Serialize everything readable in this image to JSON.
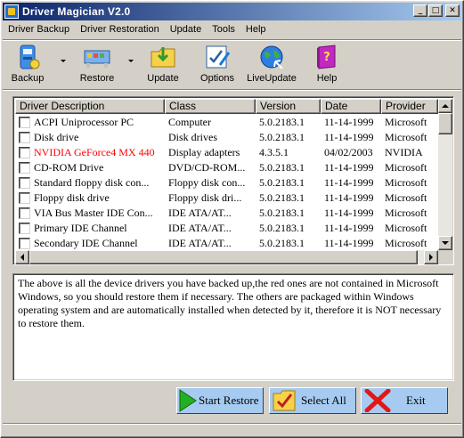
{
  "window": {
    "title": "Driver Magician V2.0"
  },
  "title_buttons": {
    "minimize": "_",
    "maximize": "□",
    "close": "✕"
  },
  "menu": [
    "Driver Backup",
    "Driver Restoration",
    "Update",
    "Tools",
    "Help"
  ],
  "toolbar": [
    {
      "label": "Backup",
      "icon": "backup-icon",
      "has_dropdown": true
    },
    {
      "label": "Restore",
      "icon": "restore-icon",
      "has_dropdown": true
    },
    {
      "label": "Update",
      "icon": "update-folder-icon",
      "has_dropdown": false
    },
    {
      "label": "Options",
      "icon": "options-icon",
      "has_dropdown": false
    },
    {
      "label": "LiveUpdate",
      "icon": "globe-icon",
      "has_dropdown": false
    },
    {
      "label": "Help",
      "icon": "help-book-icon",
      "has_dropdown": false
    }
  ],
  "driver_list": {
    "columns": [
      "Driver Description",
      "Class",
      "Version",
      "Date",
      "Provider"
    ],
    "rows": [
      {
        "description": "ACPI Uniprocessor PC",
        "class": "Computer",
        "version": "5.0.2183.1",
        "date": "11-14-1999",
        "provider": "Microsoft",
        "missing": false
      },
      {
        "description": "Disk drive",
        "class": "Disk drives",
        "version": "5.0.2183.1",
        "date": "11-14-1999",
        "provider": "Microsoft",
        "missing": false
      },
      {
        "description": "NVIDIA GeForce4 MX 440",
        "class": "Display adapters",
        "version": "4.3.5.1",
        "date": "04/02/2003",
        "provider": "NVIDIA",
        "missing": true
      },
      {
        "description": "CD-ROM Drive",
        "class": "DVD/CD-ROM...",
        "version": "5.0.2183.1",
        "date": "11-14-1999",
        "provider": "Microsoft",
        "missing": false
      },
      {
        "description": "Standard floppy disk con...",
        "class": "Floppy disk con...",
        "version": "5.0.2183.1",
        "date": "11-14-1999",
        "provider": "Microsoft",
        "missing": false
      },
      {
        "description": "Floppy disk drive",
        "class": "Floppy disk dri...",
        "version": "5.0.2183.1",
        "date": "11-14-1999",
        "provider": "Microsoft",
        "missing": false
      },
      {
        "description": "VIA Bus Master IDE Con...",
        "class": "IDE ATA/AT...",
        "version": "5.0.2183.1",
        "date": "11-14-1999",
        "provider": "Microsoft",
        "missing": false
      },
      {
        "description": "Primary IDE Channel",
        "class": "IDE ATA/AT...",
        "version": "5.0.2183.1",
        "date": "11-14-1999",
        "provider": "Microsoft",
        "missing": false
      },
      {
        "description": "Secondary IDE Channel",
        "class": "IDE ATA/AT...",
        "version": "5.0.2183.1",
        "date": "11-14-1999",
        "provider": "Microsoft",
        "missing": false
      }
    ]
  },
  "info": {
    "text": " The above is all the device drivers you have backed up,the red ones are not contained in Microsoft Windows, so you should restore them if necessary. The others are packaged within Windows operating system and are automatically installed when detected by it, therefore it is NOT necessary to restore them."
  },
  "buttons": {
    "start_restore": "Start Restore",
    "select_all": "Select All",
    "exit": "Exit"
  },
  "colors": {
    "title_gradient_start": "#0a246a",
    "title_gradient_end": "#a6caf0",
    "face": "#d4d0c8",
    "action_button": "#a6caf0",
    "missing_driver_text": "#ff0000"
  }
}
